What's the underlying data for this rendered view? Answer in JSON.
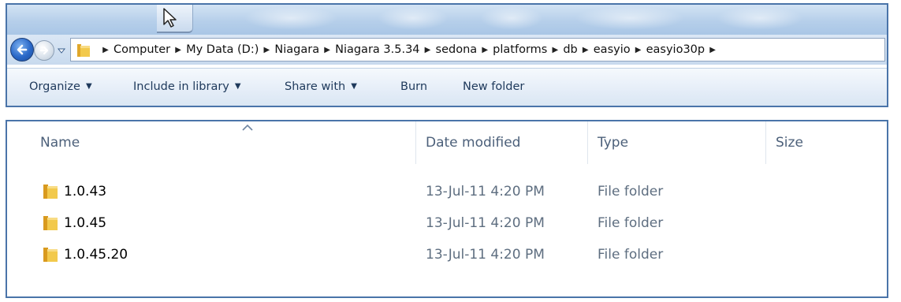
{
  "address_bar": {
    "breadcrumbs": [
      "Computer",
      "My Data (D:)",
      "Niagara",
      "Niagara 3.5.34",
      "sedona",
      "platforms",
      "db",
      "easyio",
      "easyio30p"
    ]
  },
  "toolbar": {
    "organize": "Organize",
    "include_in_library": "Include in library",
    "share_with": "Share with",
    "burn": "Burn",
    "new_folder": "New folder"
  },
  "file_list": {
    "columns": {
      "name": "Name",
      "date_modified": "Date modified",
      "type": "Type",
      "size": "Size"
    },
    "rows": [
      {
        "name": "1.0.43",
        "date_modified": "13-Jul-11 4:20 PM",
        "type": "File folder"
      },
      {
        "name": "1.0.45",
        "date_modified": "13-Jul-11 4:20 PM",
        "type": "File folder"
      },
      {
        "name": "1.0.45.20",
        "date_modified": "13-Jul-11 4:20 PM",
        "type": "File folder"
      }
    ]
  },
  "colors": {
    "window_border": "#4a74a9",
    "toolbar_text": "#1e395b",
    "header_text": "#4c607a",
    "folder_yellow": "#f2c94c"
  }
}
